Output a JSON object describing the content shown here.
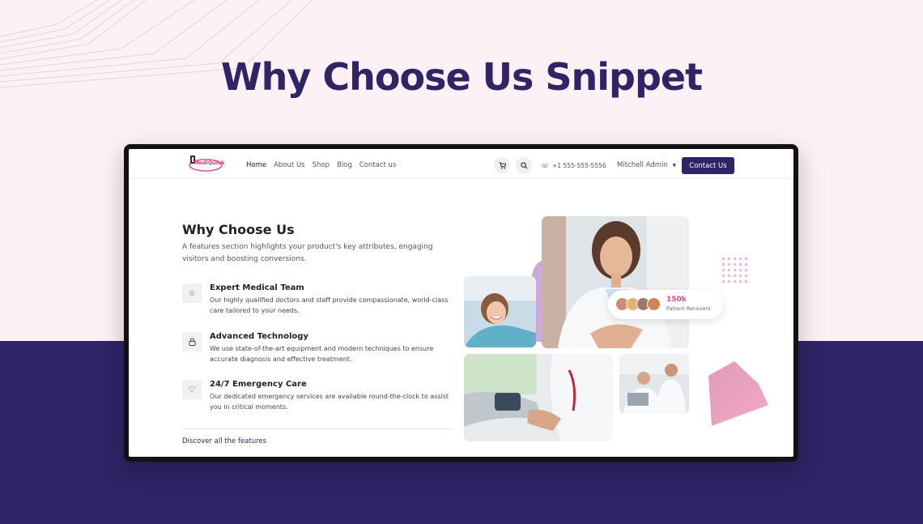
{
  "hero": {
    "title": "Why Choose Us Snippet"
  },
  "colors": {
    "brand": "#2e2466",
    "accent": "#e0508a",
    "background": "#fdf1f5"
  },
  "header": {
    "logo_text": "MediQuick",
    "nav": [
      "Home",
      "About Us",
      "Shop",
      "Blog",
      "Contact us"
    ],
    "cart_icon": "cart-icon",
    "search_icon": "search-icon",
    "phone": "+1 555-555-5556",
    "user": "Mitchell Admin",
    "cta": "Contact Us"
  },
  "section": {
    "title": "Why Choose Us",
    "subtitle": "A features section highlights your product's key attributes, engaging visitors and boosting conversions.",
    "features": [
      {
        "icon": "star-icon",
        "title": "Expert Medical Team",
        "desc": "Our highly qualified doctors and staff provide compassionate, world-class care tailored to your needs."
      },
      {
        "icon": "lock-icon",
        "title": "Advanced Technology",
        "desc": "We use state-of-the-art equipment and modern techniques to ensure accurate diagnosis and effective treatment."
      },
      {
        "icon": "heart-icon",
        "title": "24/7 Emergency Care",
        "desc": "Our dedicated emergency services are available round-the-clock to assist you in critical moments."
      }
    ],
    "link": "Discover all the features"
  },
  "badge": {
    "value": "150k",
    "label": "Patient Recovers"
  }
}
